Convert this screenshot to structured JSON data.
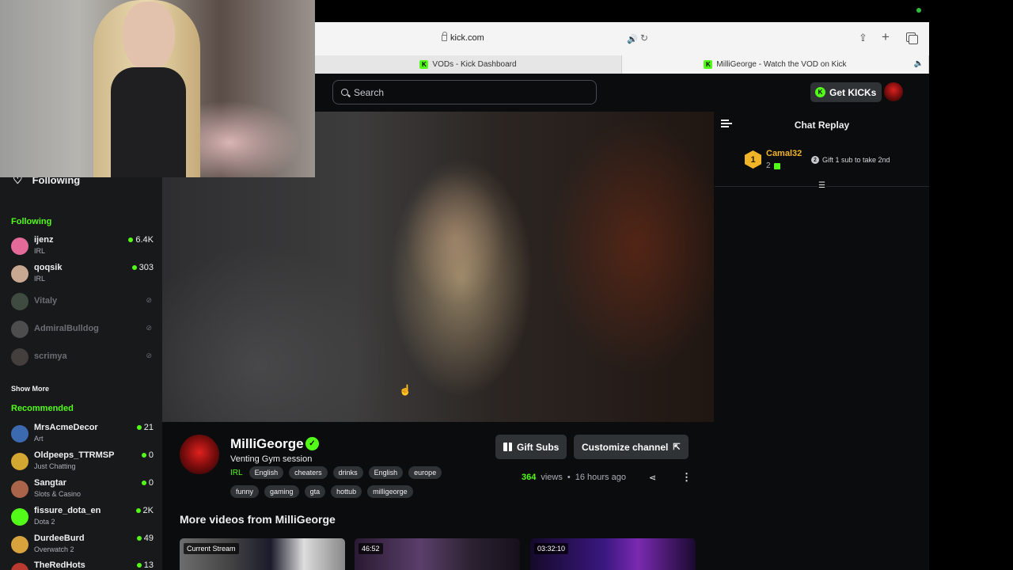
{
  "browser": {
    "url": "kick.com",
    "tabs": [
      {
        "label": "VODs - Kick Dashboard"
      },
      {
        "label": "MilliGeorge - Watch the VOD on Kick"
      }
    ]
  },
  "header": {
    "search_placeholder": "Search",
    "get_kicks_label": "Get KICKs"
  },
  "sidebar": {
    "following_top": "Following",
    "following_title": "Following",
    "following": [
      {
        "name": "ijenz",
        "category": "IRL",
        "viewers": "6.4K",
        "avatar_color": "#e46a9a",
        "live": true
      },
      {
        "name": "qoqsik",
        "category": "IRL",
        "viewers": "303",
        "avatar_color": "#c9a892",
        "live": true
      },
      {
        "name": "Vitaly",
        "live": false,
        "avatar_color": "#6f8a6e"
      },
      {
        "name": "AdmiralBulldog",
        "live": false,
        "avatar_color": "#8d8d8d"
      },
      {
        "name": "scrimya",
        "live": false,
        "avatar_color": "#7a6e66"
      }
    ],
    "show_more": "Show More",
    "recommended_title": "Recommended",
    "recommended": [
      {
        "name": "MrsAcmeDecor",
        "category": "Art",
        "viewers": "21",
        "avatar_color": "#3b6ab0"
      },
      {
        "name": "Oldpeeps_TTRMSP",
        "category": "Just Chatting",
        "viewers": "0",
        "avatar_color": "#d4a632"
      },
      {
        "name": "Sangtar",
        "category": "Slots & Casino",
        "viewers": "0",
        "avatar_color": "#a9644a"
      },
      {
        "name": "fissure_dota_en",
        "category": "Dota 2",
        "viewers": "2K",
        "avatar_color": "#53fc18"
      },
      {
        "name": "DurdeeBurd",
        "category": "Overwatch 2",
        "viewers": "49",
        "avatar_color": "#d8a23c"
      },
      {
        "name": "TheRedHots",
        "category": "",
        "viewers": "13",
        "avatar_color": "#b93a2e"
      }
    ]
  },
  "chat": {
    "title": "Chat Replay",
    "gifter": {
      "rank": "1",
      "name": "Camal32",
      "count": "2"
    },
    "gift_prompt": "Gift 1 sub to take 2nd"
  },
  "channel": {
    "name": "MilliGeorge",
    "title": "Venting Gym session",
    "category": "IRL",
    "tags_row1": [
      "English",
      "cheaters",
      "drinks",
      "English",
      "europe"
    ],
    "tags_row2": [
      "funny",
      "gaming",
      "gta",
      "hottub",
      "milligeorge"
    ],
    "gift_subs_label": "Gift Subs",
    "customize_label": "Customize channel",
    "views": "364",
    "views_word": "views",
    "separator": "•",
    "time_ago": "16 hours ago",
    "more_videos_title": "More videos from MilliGeorge",
    "videos": [
      {
        "label": "Current Stream"
      },
      {
        "label": "46:52"
      },
      {
        "label": "03:32:10"
      }
    ]
  },
  "colors": {
    "brand": "#53fc18",
    "background": "#0b0c0d",
    "sidebar": "#18191b",
    "button": "#2f3335",
    "gifter_gold": "#f0b429"
  }
}
